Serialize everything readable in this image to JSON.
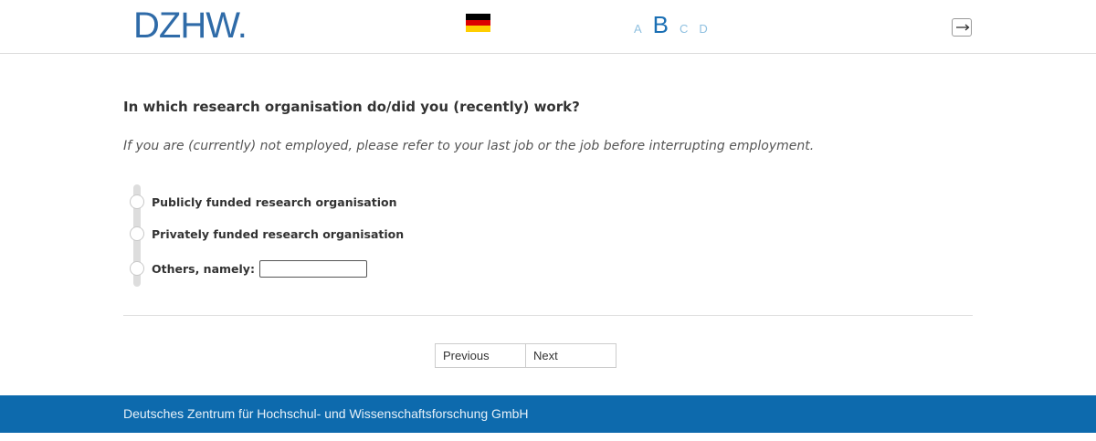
{
  "header": {
    "logo_text": "DZHW.",
    "language_flag": "german-flag-icon",
    "steps": [
      "A",
      "B",
      "C",
      "D"
    ],
    "active_step": "B",
    "logout_icon": "logout-icon"
  },
  "main": {
    "question": "In which research organisation do/did you (recently) work?",
    "instruction": "If you are (currently) not employed, please refer to your last job or the job before interrupting employment.",
    "options": [
      {
        "label": "Publicly funded research organisation"
      },
      {
        "label": "Privately funded research organisation"
      },
      {
        "label": "Others, namely:",
        "input_value": ""
      }
    ]
  },
  "navigation": {
    "previous_label": "Previous",
    "next_label": "Next"
  },
  "footer": {
    "text": "Deutsches Zentrum für Hochschul- und Wissenschaftsforschung GmbH"
  },
  "colors": {
    "brand": "#2f6ba8",
    "footer": "#0d6aad",
    "active_step": "#1a6fb4",
    "inactive_step": "#8fc0e0"
  }
}
